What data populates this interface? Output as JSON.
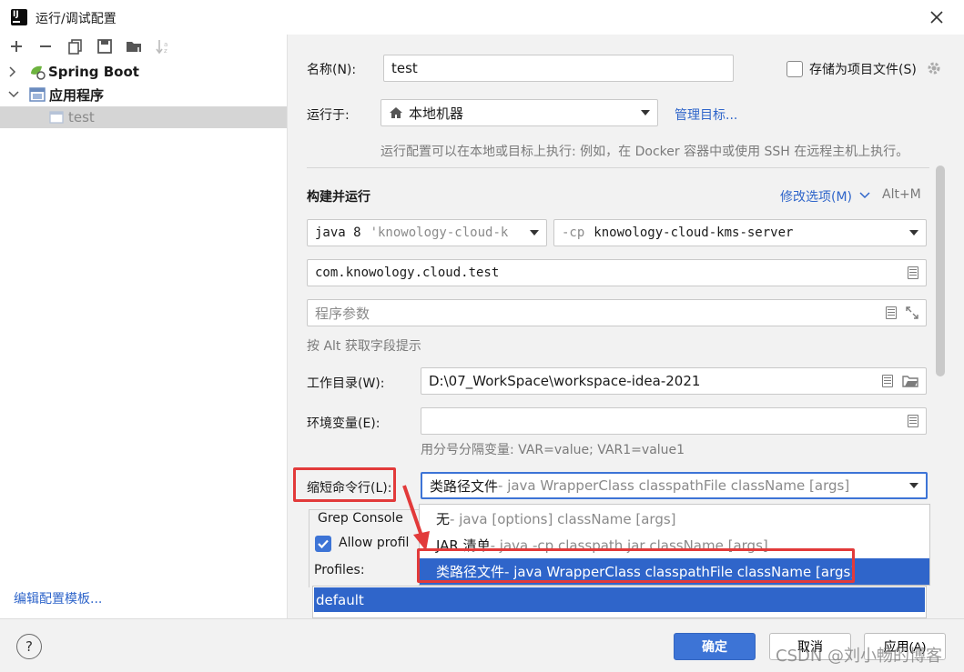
{
  "window": {
    "title": "运行/调试配置"
  },
  "left": {
    "tree": [
      {
        "label": "Spring Boot",
        "expanded": false
      },
      {
        "label": "应用程序",
        "expanded": true
      },
      {
        "label": "test",
        "selected": true
      }
    ],
    "edit_templates_link": "编辑配置模板..."
  },
  "form": {
    "name_label": "名称(N):",
    "name_value": "test",
    "store_as_project_file_label": "存储为项目文件(S)",
    "run_on_label": "运行于:",
    "run_on_value": "本地机器",
    "manage_targets_link": "管理目标...",
    "run_on_hint": "运行配置可以在本地或目标上执行: 例如，在 Docker 容器中或使用 SSH 在远程主机上执行。",
    "build_run_title": "构建并运行",
    "modify_options_link": "修改选项(M)",
    "modify_options_shortcut": "Alt+M",
    "jre_value": "java 8",
    "jre_hint": "'knowology-cloud-k",
    "cp_prefix": "-cp",
    "cp_value": "knowology-cloud-kms-server",
    "main_class_value": "com.knowology.cloud.test",
    "program_args_placeholder": "程序参数",
    "alt_hint": "按 Alt 获取字段提示",
    "workdir_label": "工作目录(W):",
    "workdir_value": "D:\\07_WorkSpace\\workspace-idea-2021",
    "env_label": "环境变量(E):",
    "env_value": "",
    "env_hint": "用分号分隔变量: VAR=value; VAR1=value1",
    "shorten_label": "缩短命令行(L):",
    "shorten_value_main": "类路径文件",
    "shorten_value_sub": " - java WrapperClass classpathFile className [args]",
    "grep_console_label": "Grep Console",
    "allow_profiles_label": "Allow profil",
    "profiles_label": "Profiles:",
    "profiles": [
      "default"
    ]
  },
  "shorten_options": [
    {
      "main": "无",
      "sub": " - java [options] className [args]",
      "selected": false
    },
    {
      "main": "JAR 清单",
      "sub": " - java -cp classpath.jar className [args]",
      "selected": false
    },
    {
      "main": "类路径文件",
      "sub": " - java WrapperClass classpathFile className [args]",
      "selected": true
    }
  ],
  "buttons": {
    "ok": "确定",
    "cancel": "取消",
    "apply": "应用(A)",
    "help": "?"
  },
  "watermark": "CSDN @刘小畅的博客",
  "colors": {
    "accent": "#2f65ca",
    "primary_button": "#3d74d6",
    "highlight_box": "#e23a3a"
  }
}
